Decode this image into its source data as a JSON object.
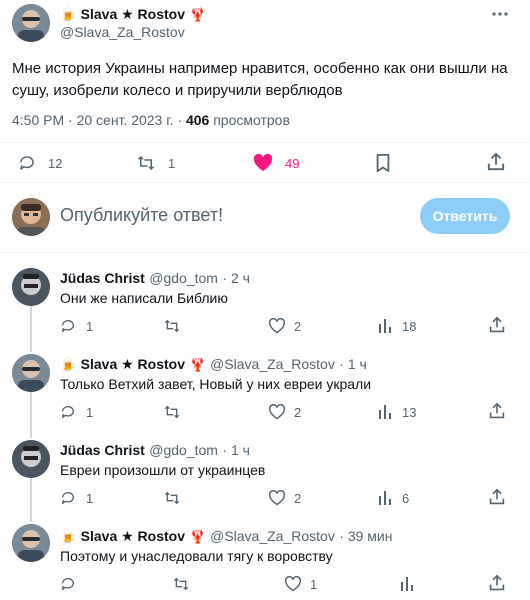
{
  "main_tweet": {
    "author_name": "Slava ★ Rostov",
    "author_emoji_left": "🍺",
    "author_emoji_right": "🦞",
    "handle": "@Slava_Za_Rostov",
    "text_line1": "Мне история Украины например нравится, особенно как они вышли на",
    "text_line2": "сушу, изобрели колесо и приручили верблюдов",
    "time": "4:50 PM · 20 сент. 2023 г. · ",
    "views_count": "406",
    "views_label": " просмотров",
    "replies": "12",
    "retweets": "1",
    "likes": "49",
    "liked": true
  },
  "compose": {
    "placeholder": "Опубликуйте ответ!",
    "button_label": "Ответить"
  },
  "replies": [
    {
      "name": "Jüdas Christ",
      "handle": "@gdo_tom",
      "time": "· 2 ч",
      "text": "Они же написали Библию",
      "replies": "1",
      "retweets": "",
      "likes": "2",
      "views": "18"
    },
    {
      "name": "Slava ★ Rostov",
      "handle": "@Slava_Za_Rostov",
      "time": "· 1 ч",
      "text": "Только Ветхий завет, Новый у них евреи украли",
      "replies": "1",
      "retweets": "",
      "likes": "2",
      "views": "13"
    },
    {
      "name": "Jüdas Christ",
      "handle": "@gdo_tom",
      "time": "· 1 ч",
      "text": "Евреи произошли от украинцев",
      "replies": "1",
      "retweets": "",
      "likes": "2",
      "views": "6"
    },
    {
      "name": "Slava ★ Rostov",
      "handle": "@Slava_Za_Rostov",
      "time": "· 39 мин",
      "text": "Поэтому и унаследовали тягу к воровству",
      "replies": "",
      "retweets": "",
      "likes": "1",
      "views": ""
    }
  ],
  "colors": {
    "like_active": "#f91880",
    "accent_disabled": "#8ecdf8",
    "text_secondary": "#536471"
  },
  "icons": [
    "more-icon",
    "reply-icon",
    "retweet-icon",
    "like-icon",
    "bookmark-icon",
    "share-icon",
    "views-icon"
  ]
}
